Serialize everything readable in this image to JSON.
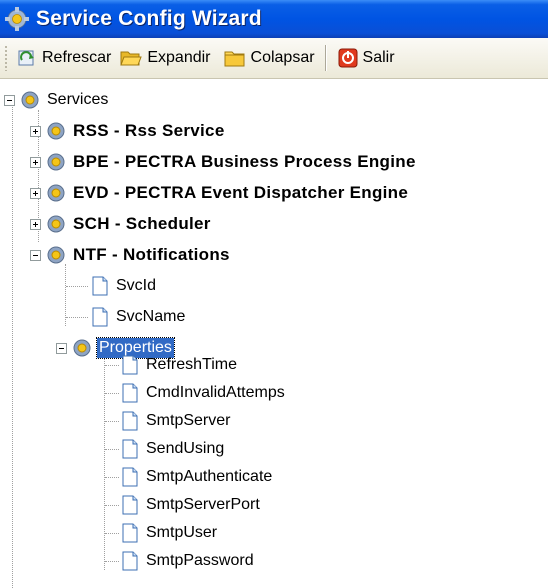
{
  "window": {
    "title": "Service Config Wizard",
    "title_icon": "gear-icon"
  },
  "toolbar": {
    "refresh_label": "Refrescar",
    "expand_label": "Expandir",
    "collapse_label": "Colapsar",
    "exit_label": "Salir"
  },
  "tree": {
    "root": "Services",
    "services": [
      {
        "label": "RSS - Rss Service",
        "expanded": false
      },
      {
        "label": "BPE - PECTRA Business Process Engine",
        "expanded": false
      },
      {
        "label": "EVD - PECTRA Event Dispatcher Engine",
        "expanded": false
      },
      {
        "label": "SCH - Scheduler",
        "expanded": false
      },
      {
        "label": "NTF - Notifications",
        "expanded": true
      }
    ],
    "ntf_children": [
      "SvcId",
      "SvcName"
    ],
    "properties_label": "Properties",
    "properties": [
      "RefreshTime",
      "CmdInvalidAttemps",
      "SmtpServer",
      "SendUsing",
      "SmtpAuthenticate",
      "SmtpServerPort",
      "SmtpUser",
      "SmtpPassword"
    ]
  }
}
